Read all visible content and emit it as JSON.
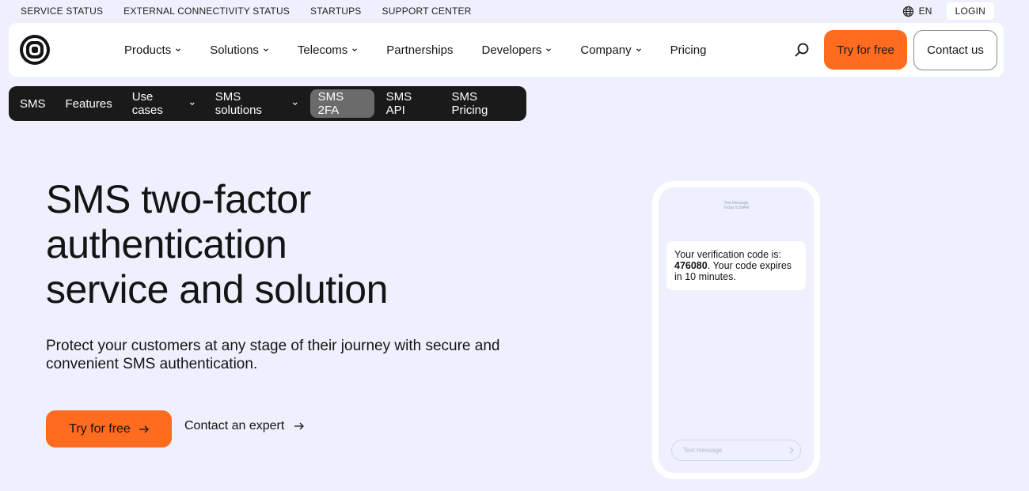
{
  "utility": {
    "links": [
      "SERVICE STATUS",
      "EXTERNAL CONNECTIVITY STATUS",
      "STARTUPS",
      "SUPPORT CENTER"
    ],
    "lang": "EN",
    "login": "LOGIN"
  },
  "nav": {
    "items": [
      {
        "label": "Products",
        "dropdown": true
      },
      {
        "label": "Solutions",
        "dropdown": true
      },
      {
        "label": "Telecoms",
        "dropdown": true
      },
      {
        "label": "Partnerships",
        "dropdown": false
      },
      {
        "label": "Developers",
        "dropdown": true
      },
      {
        "label": "Company",
        "dropdown": true
      },
      {
        "label": "Pricing",
        "dropdown": false
      }
    ],
    "try_label": "Try for free",
    "contact_label": "Contact us"
  },
  "subnav": {
    "items": [
      {
        "label": "SMS",
        "dropdown": false,
        "active": false
      },
      {
        "label": "Features",
        "dropdown": false,
        "active": false
      },
      {
        "label": "Use cases",
        "dropdown": true,
        "active": false
      },
      {
        "label": "SMS solutions",
        "dropdown": true,
        "active": false
      },
      {
        "label": "SMS 2FA",
        "dropdown": false,
        "active": true
      },
      {
        "label": "SMS API",
        "dropdown": false,
        "active": false
      },
      {
        "label": "SMS Pricing",
        "dropdown": false,
        "active": false
      }
    ]
  },
  "hero": {
    "title_lines": [
      "SMS two-factor",
      "authentication",
      "service and solution"
    ],
    "description": "Protect your customers at any stage of their journey with secure and convenient SMS authentication.",
    "try_label": "Try for free",
    "contact_label": "Contact an expert"
  },
  "phone": {
    "meta_line1": "Text Message",
    "meta_line2": "Today 9:39AM",
    "message_prefix": "Your verification code is:",
    "code": "476080",
    "message_suffix": ". Your code expires in 10 minutes.",
    "input_placeholder": "Text message"
  },
  "colors": {
    "accent": "#ff6b1f",
    "background": "#eef1fd",
    "subnav_bg": "#1a1a1a"
  }
}
